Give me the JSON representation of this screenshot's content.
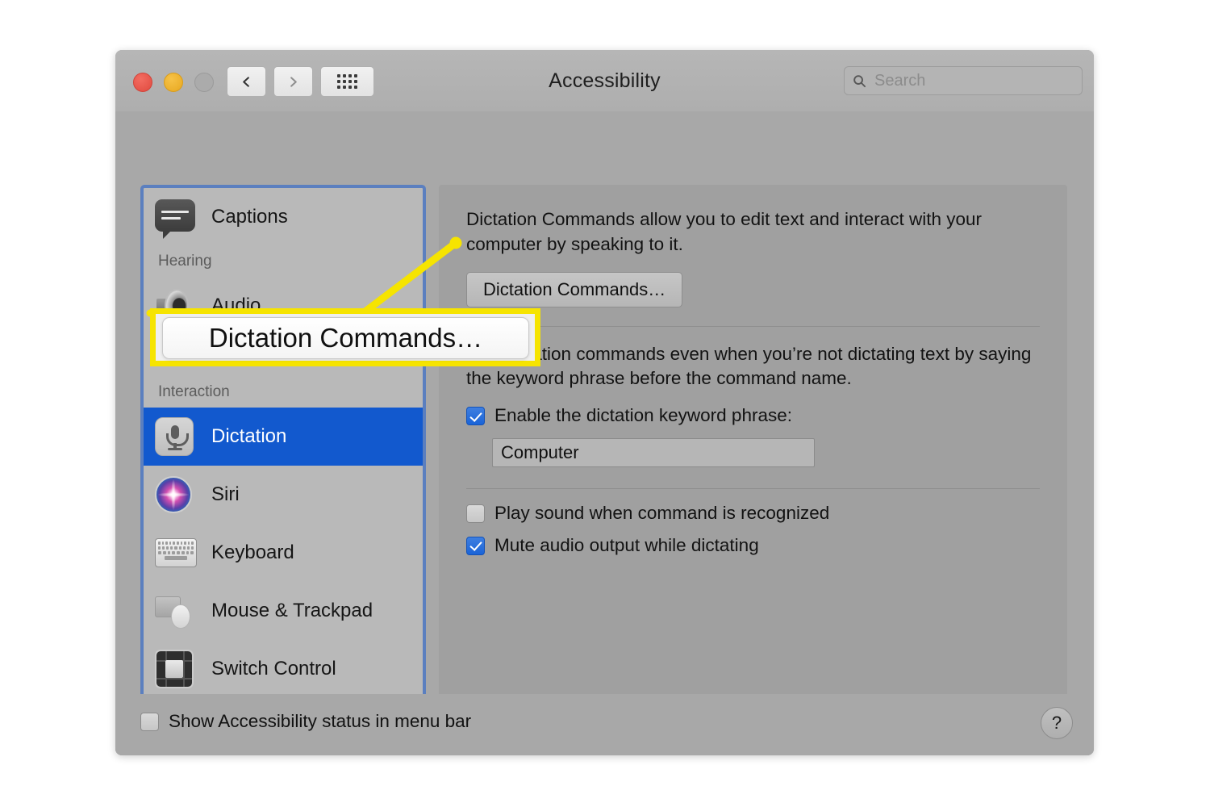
{
  "window": {
    "title": "Accessibility",
    "traffic_lights": [
      "close",
      "minimize",
      "zoom"
    ],
    "nav": {
      "back_icon": "chevron-left-icon",
      "forward_icon": "chevron-right-icon",
      "grid_icon": "show-all-grid-icon"
    },
    "search": {
      "placeholder": "Search",
      "value": "",
      "icon": "search-icon"
    }
  },
  "sidebar": {
    "items": [
      {
        "type": "item",
        "label": "Captions",
        "icon": "captions-icon",
        "selected": false
      },
      {
        "type": "group",
        "label": "Hearing"
      },
      {
        "type": "item",
        "label": "Audio",
        "icon": "speaker-icon",
        "selected": false
      },
      {
        "type": "group",
        "label": "Interaction"
      },
      {
        "type": "item",
        "label": "Dictation",
        "icon": "microphone-icon",
        "selected": true
      },
      {
        "type": "item",
        "label": "Siri",
        "icon": "siri-icon",
        "selected": false
      },
      {
        "type": "item",
        "label": "Keyboard",
        "icon": "keyboard-icon",
        "selected": false
      },
      {
        "type": "item",
        "label": "Mouse & Trackpad",
        "icon": "mouse-trackpad-icon",
        "selected": false
      },
      {
        "type": "item",
        "label": "Switch Control",
        "icon": "switch-control-icon",
        "selected": false
      }
    ]
  },
  "panel": {
    "description": "Dictation Commands allow you to edit text and interact with your computer by speaking to it.",
    "dictation_commands_button": "Dictation Commands…",
    "keyword_description": "Use dictation commands even when you’re not dictating text by saying the keyword phrase before the command name.",
    "enable_keyword_label": "Enable the dictation keyword phrase:",
    "enable_keyword_checked": true,
    "keyword_value": "Computer",
    "play_sound_label": "Play sound when command is recognized",
    "play_sound_checked": false,
    "mute_audio_label": "Mute audio output while dictating",
    "mute_audio_checked": true
  },
  "footer": {
    "show_status_label": "Show Accessibility status in menu bar",
    "show_status_checked": false,
    "help_label": "?"
  },
  "callout": {
    "label": "Dictation Commands…",
    "highlight_color": "#f6e400",
    "line_color": "#f6e400"
  },
  "colors": {
    "window_bg": "#a8a8a8",
    "titlebar_bg": "#b2b2b2",
    "panel_bg": "#a0a0a0",
    "sidebar_bg": "#b9b9b9",
    "selection_blue": "#1259ce",
    "focus_ring_blue": "#5b7fbf",
    "checkbox_blue": "#1a64d8"
  }
}
